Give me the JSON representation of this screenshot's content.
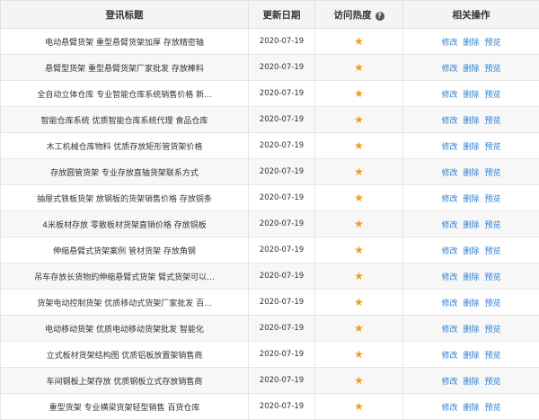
{
  "header": {
    "title_col": "登讯标题",
    "date_col": "更新日期",
    "hot_col": "访问热度",
    "hot_help_icon": "help-icon",
    "actions_col": "相关操作"
  },
  "actions": {
    "edit": "修改",
    "delete": "删除",
    "preview": "预览"
  },
  "star_icon": "star-icon",
  "star_color": "#f39b1b",
  "link_color": "#2e7fd6",
  "rows": [
    {
      "title": "电动悬臂货架 重型悬臂货架加厚 存放精密轴",
      "date": "2020-07-19",
      "stars": 1
    },
    {
      "title": "悬臂型货架 重型悬臂货架厂家批发 存放棒料",
      "date": "2020-07-19",
      "stars": 1
    },
    {
      "title": "全自动立体仓库 专业智能仓库系统销售价格 新...",
      "date": "2020-07-19",
      "stars": 1
    },
    {
      "title": "智能仓库系统 优质智能仓库系统代理 食品仓库",
      "date": "2020-07-19",
      "stars": 1
    },
    {
      "title": "木工机械仓库物料 优质存放矩形管货架价格",
      "date": "2020-07-19",
      "stars": 1
    },
    {
      "title": "存放圆管货架 专业存放直轴货架联系方式",
      "date": "2020-07-19",
      "stars": 1
    },
    {
      "title": "抽屉式铁板货架 放钢板的货架销售价格 存放铜条",
      "date": "2020-07-19",
      "stars": 1
    },
    {
      "title": "4米板材存放 零散板材货架直销价格 存放铜板",
      "date": "2020-07-19",
      "stars": 1
    },
    {
      "title": "伸缩悬臂式货架案例 管材货架 存放角钢",
      "date": "2020-07-19",
      "stars": 1
    },
    {
      "title": "吊车存放长货物的伸缩悬臂式货架 臂式货架可以...",
      "date": "2020-07-19",
      "stars": 1
    },
    {
      "title": "货架电动控制货架 优质移动式货架厂家批发 百...",
      "date": "2020-07-19",
      "stars": 1
    },
    {
      "title": "电动移动货架 优质电动移动货架批发 智能化",
      "date": "2020-07-19",
      "stars": 1
    },
    {
      "title": "立式板材货架结构图 优质铝板放置架销售商",
      "date": "2020-07-19",
      "stars": 1
    },
    {
      "title": "车间钢板上架存放 优质钢板立式存放销售商",
      "date": "2020-07-19",
      "stars": 1
    },
    {
      "title": "重型货架 专业横梁货架轻型销售 百货仓库",
      "date": "2020-07-19",
      "stars": 1
    }
  ]
}
